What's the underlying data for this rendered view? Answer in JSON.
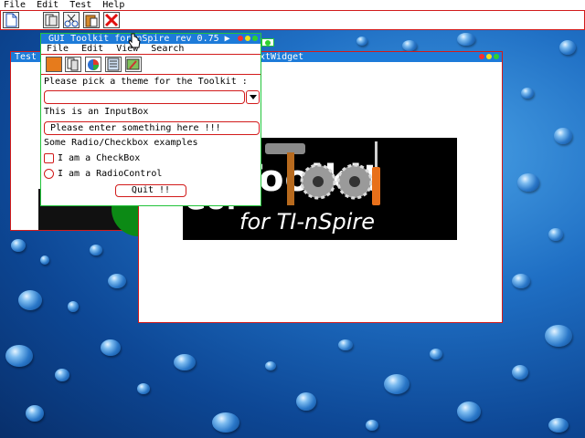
{
  "menubar": {
    "items": [
      "File",
      "Edit",
      "Test",
      "Help"
    ]
  },
  "toolbar": {
    "icons": [
      "document-icon",
      "page-icon",
      "cut-icon",
      "paste-icon",
      "close-icon"
    ]
  },
  "test_window": {
    "title": "Test"
  },
  "text_widget_window": {
    "title_visible": "xtWidget",
    "logo": {
      "text_big": "Toolkit",
      "text_prefix": "GUI",
      "text_sub": "for TI-nSpire"
    }
  },
  "dialog": {
    "title": "GUI Toolkit for nSpire rev 0.75 ▶",
    "menu": [
      "File",
      "Edit",
      "View",
      "Search"
    ],
    "theme_prompt": "Please pick a theme for the Toolkit :",
    "inputbox_label": "This is an InputBox",
    "inputbox_placeholder": "Please enter something here !!!",
    "examples_label": "Some Radio/Checkbox examples",
    "checkbox_label": "I am a CheckBox",
    "radio_label": "I am a RadioControl",
    "quit_label": "Quit !!"
  },
  "colors": {
    "accent_border": "#d21b1b",
    "titlebar": "#1d7bd9",
    "dialog_border": "#22c33a"
  }
}
